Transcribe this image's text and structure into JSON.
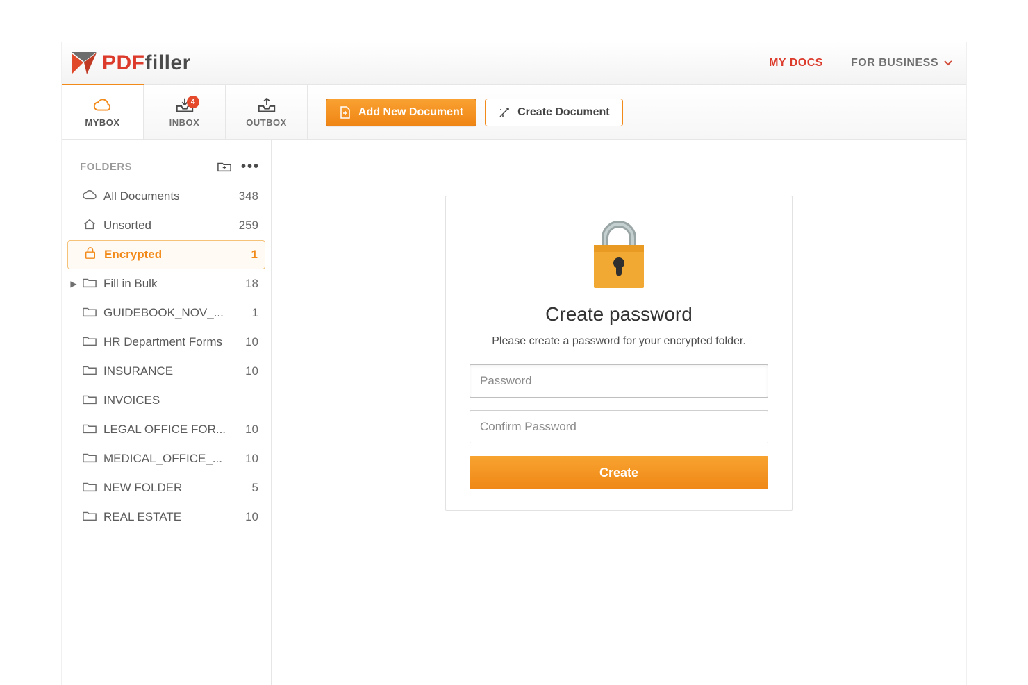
{
  "brand": {
    "prefix": "PDF",
    "suffix": "filler"
  },
  "topnav": {
    "mydocs": "MY DOCS",
    "business": "FOR BUSINESS"
  },
  "tabs": {
    "mybox": "MYBOX",
    "inbox": "INBOX",
    "outbox": "OUTBOX",
    "inbox_badge": "4"
  },
  "actions": {
    "add": "Add New Document",
    "create": "Create Document"
  },
  "sidebar": {
    "heading": "FOLDERS",
    "items": [
      {
        "icon": "cloud",
        "label": "All Documents",
        "count": "348",
        "selected": false
      },
      {
        "icon": "home",
        "label": "Unsorted",
        "count": "259",
        "selected": false
      },
      {
        "icon": "lock",
        "label": "Encrypted",
        "count": "1",
        "selected": true
      },
      {
        "icon": "folder",
        "label": "Fill in Bulk",
        "count": "18",
        "selected": false,
        "caret": true
      },
      {
        "icon": "folder",
        "label": "GUIDEBOOK_NOV_...",
        "count": "1",
        "selected": false
      },
      {
        "icon": "folder",
        "label": "HR Department Forms",
        "count": "10",
        "selected": false
      },
      {
        "icon": "folder",
        "label": "INSURANCE",
        "count": "10",
        "selected": false
      },
      {
        "icon": "folder",
        "label": "INVOICES",
        "count": "",
        "selected": false
      },
      {
        "icon": "folder",
        "label": "LEGAL OFFICE FOR...",
        "count": "10",
        "selected": false
      },
      {
        "icon": "folder",
        "label": "MEDICAL_OFFICE_...",
        "count": "10",
        "selected": false
      },
      {
        "icon": "folder",
        "label": "NEW FOLDER",
        "count": "5",
        "selected": false
      },
      {
        "icon": "folder",
        "label": "REAL ESTATE",
        "count": "10",
        "selected": false
      }
    ]
  },
  "card": {
    "title": "Create password",
    "subtitle": "Please create a password for your encrypted folder.",
    "password_ph": "Password",
    "confirm_ph": "Confirm Password",
    "submit": "Create"
  }
}
